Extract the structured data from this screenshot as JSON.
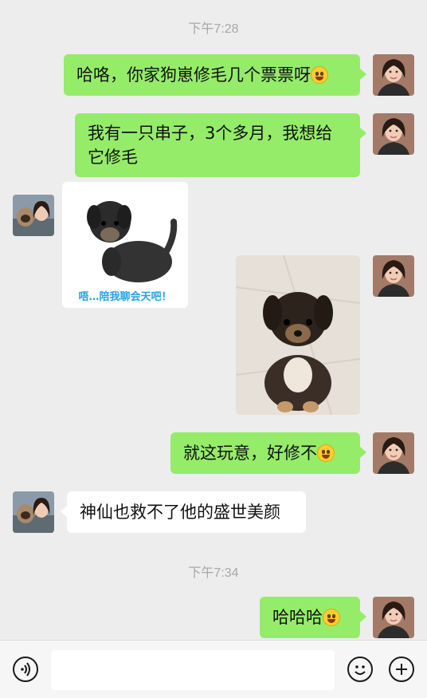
{
  "chat": {
    "timestamp_1": "下午7:28",
    "timestamp_2": "下午7:34",
    "messages": [
      {
        "from": "me",
        "text": "哈咯，你家狗崽修毛几个票票呀",
        "emoji": "smirk-emoji"
      },
      {
        "from": "me",
        "text": "我有一只串子，3个多月，我想给它修毛"
      },
      {
        "from": "them",
        "type": "sticker",
        "caption": "唔…陪我聊会天吧！"
      },
      {
        "from": "me",
        "type": "photo",
        "image": "puppy-photo"
      },
      {
        "from": "me",
        "text": "就这玩意，好修不",
        "emoji": "crying-laugh-emoji"
      },
      {
        "from": "them",
        "text": "神仙也救不了他的盛世美颜"
      },
      {
        "from": "me",
        "text": "哈哈哈",
        "emoji": "crying-laugh-emoji"
      }
    ]
  },
  "input_bar": {
    "voice_icon": "voice-icon",
    "emoji_icon": "emoji-icon",
    "plus_icon": "plus-icon",
    "text_value": ""
  },
  "colors": {
    "background": "#ededed",
    "outgoing_bubble": "#95ec69",
    "incoming_bubble": "#ffffff",
    "timestamp": "#a7a7a7"
  }
}
